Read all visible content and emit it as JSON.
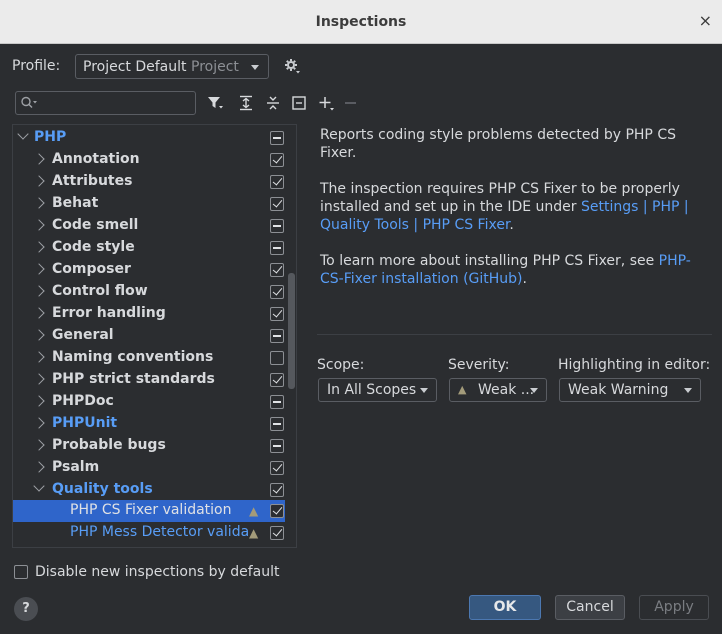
{
  "window": {
    "title": "Inspections",
    "close_glyph": "×"
  },
  "profile": {
    "label": "Profile:",
    "name": "Project Default",
    "scope": "Project"
  },
  "search": {
    "placeholder": ""
  },
  "toolbar": {
    "icons": [
      "filter-icon",
      "expand-all-icon",
      "collapse-all-icon",
      "reset-icon",
      "add-icon",
      "remove-icon"
    ]
  },
  "tree": {
    "root": {
      "label": "PHP",
      "state": "mixed"
    },
    "items": [
      {
        "label": "Annotation",
        "state": "checked"
      },
      {
        "label": "Attributes",
        "state": "checked"
      },
      {
        "label": "Behat",
        "state": "checked"
      },
      {
        "label": "Code smell",
        "state": "mixed"
      },
      {
        "label": "Code style",
        "state": "mixed"
      },
      {
        "label": "Composer",
        "state": "checked"
      },
      {
        "label": "Control flow",
        "state": "checked"
      },
      {
        "label": "Error handling",
        "state": "checked"
      },
      {
        "label": "General",
        "state": "mixed"
      },
      {
        "label": "Naming conventions",
        "state": "unchecked"
      },
      {
        "label": "PHP strict standards",
        "state": "checked"
      },
      {
        "label": "PHPDoc",
        "state": "mixed"
      },
      {
        "label": "PHPUnit",
        "state": "mixed"
      },
      {
        "label": "Probable bugs",
        "state": "mixed"
      },
      {
        "label": "Psalm",
        "state": "checked"
      },
      {
        "label": "Quality tools",
        "state": "checked"
      }
    ],
    "children": [
      {
        "label": "PHP CS Fixer validation",
        "state": "checked"
      },
      {
        "label": "PHP Mess Detector valida",
        "state": "checked"
      }
    ]
  },
  "description": {
    "p1": "Reports coding style problems detected by PHP CS Fixer.",
    "p2_text": "The inspection requires PHP CS Fixer to be properly installed and set up in the IDE under ",
    "p2_link": "Settings | PHP | Quality Tools | PHP CS Fixer",
    "p2_end": ".",
    "p3_text": "To learn more about installing PHP CS Fixer, see ",
    "p3_link": "PHP-CS-Fixer installation (GitHub)",
    "p3_end": "."
  },
  "options": {
    "scope_label": "Scope:",
    "scope_value": "In All Scopes",
    "severity_label": "Severity:",
    "severity_value": "Weak ...",
    "highlight_label": "Highlighting in editor:",
    "highlight_value": "Weak Warning"
  },
  "footer": {
    "disable_label": "Disable new inspections by default",
    "help": "?",
    "ok": "OK",
    "cancel": "Cancel",
    "apply": "Apply"
  },
  "colors": {
    "accent": "#589df6",
    "selection": "#2f65ca",
    "background": "#2b2d30",
    "warning": "#a39b7a"
  }
}
